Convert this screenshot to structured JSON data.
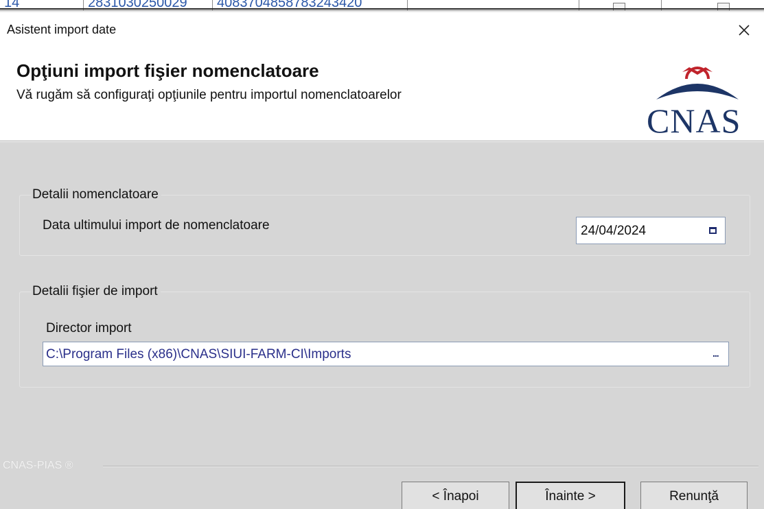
{
  "background_window": {
    "cells": [
      "14",
      "2831030250029",
      "4083704858783243420"
    ]
  },
  "dialog": {
    "title": "Asistent import date",
    "close_icon": "close-icon"
  },
  "header": {
    "title": "Opţiuni import fişier nomenclatoare",
    "subtitle": "Vă rugăm să configuraţi opţiunile pentru importul nomenclatoarelor",
    "logo_text": "CNAS"
  },
  "nomenclature_group": {
    "legend": "Detalii nomenclatoare",
    "last_import_label": "Data ultimului import de nomenclatoare",
    "last_import_value": "24/04/2024",
    "calendar_icon": "calendar-icon"
  },
  "import_file_group": {
    "legend": "Detalii fişier de import",
    "directory_label": "Director import",
    "directory_value": "C:\\Program Files (x86)\\CNAS\\SIUI-FARM-CI\\Imports",
    "browse_label": "..."
  },
  "footer": {
    "brand": "CNAS-PIAS ®",
    "back_label": "< Înapoi",
    "next_label": "Înainte >",
    "cancel_label": "Renunţă"
  },
  "colors": {
    "logo_blue": "#1d3566",
    "logo_red": "#c0232b",
    "path_text": "#2a2f8a",
    "panel_bg": "#d6d6d6"
  }
}
